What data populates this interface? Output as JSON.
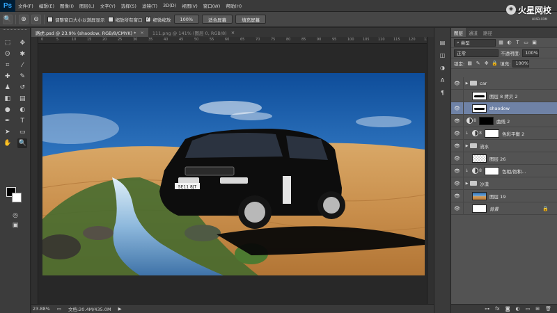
{
  "menubar": {
    "logo": "Ps",
    "items": [
      "文件(F)",
      "编辑(E)",
      "图像(I)",
      "图层(L)",
      "文字(Y)",
      "选择(S)",
      "滤镜(T)",
      "3D(D)",
      "视图(V)",
      "窗口(W)",
      "帮助(H)"
    ]
  },
  "brand": {
    "name": "火星网校",
    "sub": "HXSD.COM"
  },
  "options": {
    "resize_windows": "调整窗口大小以满屏显示",
    "zoom_all": "缩放所有窗口",
    "scrubby_zoom": "细微缩放",
    "btn_100": "100%",
    "btn_fit": "适合屏幕",
    "btn_fill": "填充屏幕"
  },
  "tabs": [
    {
      "label": "路虎.psd @ 23.9% (shaodow, RGB/8/CMYK) *",
      "close": "×"
    },
    {
      "label": "111.png @ 141% (图层 0, RGB/8)",
      "close": "×"
    }
  ],
  "ruler": {
    "h": [
      "0",
      "5",
      "10",
      "15",
      "20",
      "25",
      "30",
      "35",
      "40",
      "45",
      "50",
      "55",
      "60",
      "65",
      "70",
      "75",
      "80",
      "85",
      "90",
      "95",
      "100",
      "105",
      "110",
      "115",
      "120",
      "125"
    ]
  },
  "status": {
    "zoom": "23.88%",
    "doc": "文档:20.4M/435.0M"
  },
  "panel": {
    "tabs": [
      "图层",
      "通道",
      "路径"
    ],
    "kind": "类型",
    "blend": "正常",
    "opacity_label": "不透明度:",
    "opacity": "100%",
    "lock_label": "锁定:",
    "fill_label": "填充:",
    "fill": "100%"
  },
  "layers": [
    {
      "name": "car",
      "type": "group",
      "visible": true
    },
    {
      "name": "图层 8 拷贝 2",
      "type": "shape",
      "visible": false
    },
    {
      "name": "shaodow",
      "type": "shape",
      "visible": true,
      "selected": true
    },
    {
      "name": "曲线 2",
      "type": "adjust-black",
      "visible": true
    },
    {
      "name": "色彩平衡 2",
      "type": "adjust-clip",
      "visible": true
    },
    {
      "name": "流水",
      "type": "group",
      "visible": true
    },
    {
      "name": "图层 26",
      "type": "checker",
      "visible": true
    },
    {
      "name": "色相/饱和...",
      "type": "adjust-clip",
      "visible": true
    },
    {
      "name": "沙漠",
      "type": "group",
      "visible": true
    },
    {
      "name": "图层 19",
      "type": "photo",
      "visible": true
    },
    {
      "name": "背景",
      "type": "background",
      "visible": true,
      "locked": true
    }
  ],
  "canvas": {
    "plate": "SE11 8JT"
  },
  "colors": {
    "selected_layer": "#6f82a6",
    "sky": "#2f6fb0",
    "sand": "#d49c58"
  }
}
